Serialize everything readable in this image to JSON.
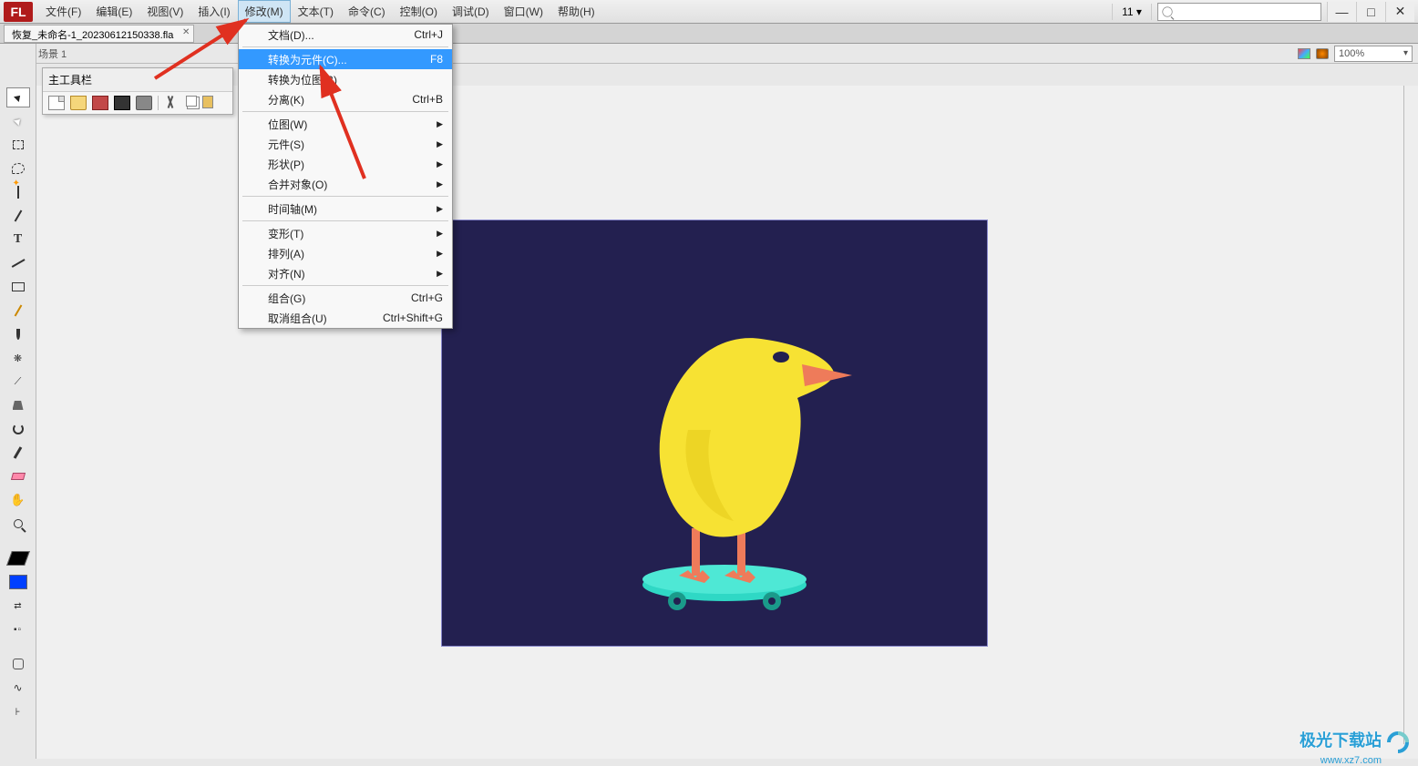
{
  "app": {
    "logo": "FL"
  },
  "menus": {
    "items": [
      {
        "label": "文件(F)"
      },
      {
        "label": "编辑(E)"
      },
      {
        "label": "视图(V)"
      },
      {
        "label": "插入(I)"
      },
      {
        "label": "修改(M)",
        "active": true
      },
      {
        "label": "文本(T)"
      },
      {
        "label": "命令(C)"
      },
      {
        "label": "控制(O)"
      },
      {
        "label": "调试(D)"
      },
      {
        "label": "窗口(W)"
      },
      {
        "label": "帮助(H)"
      }
    ]
  },
  "title_right": {
    "page": "11",
    "search_placeholder": ""
  },
  "tabs": {
    "doc": "恢复_未命名-1_20230612150338.fla"
  },
  "scene": {
    "name": "场景 1",
    "zoom": "100%"
  },
  "toolbar": {
    "title": "主工具栏"
  },
  "dropdown": {
    "items": [
      {
        "label": "文档(D)...",
        "shortcut": "Ctrl+J",
        "type": "item"
      },
      {
        "type": "sep"
      },
      {
        "label": "转换为元件(C)...",
        "shortcut": "F8",
        "type": "item",
        "highlight": true
      },
      {
        "label": "转换为位图(B)",
        "shortcut": "",
        "type": "item"
      },
      {
        "label": "分离(K)",
        "shortcut": "Ctrl+B",
        "type": "item"
      },
      {
        "type": "sep"
      },
      {
        "label": "位图(W)",
        "submenu": true,
        "type": "item"
      },
      {
        "label": "元件(S)",
        "submenu": true,
        "type": "item"
      },
      {
        "label": "形状(P)",
        "submenu": true,
        "type": "item"
      },
      {
        "label": "合并对象(O)",
        "submenu": true,
        "type": "item"
      },
      {
        "type": "sep"
      },
      {
        "label": "时间轴(M)",
        "submenu": true,
        "type": "item"
      },
      {
        "type": "sep"
      },
      {
        "label": "变形(T)",
        "submenu": true,
        "type": "item"
      },
      {
        "label": "排列(A)",
        "submenu": true,
        "type": "item"
      },
      {
        "label": "对齐(N)",
        "submenu": true,
        "type": "item"
      },
      {
        "type": "sep"
      },
      {
        "label": "组合(G)",
        "shortcut": "Ctrl+G",
        "type": "item"
      },
      {
        "label": "取消组合(U)",
        "shortcut": "Ctrl+Shift+G",
        "type": "item"
      }
    ]
  },
  "colors": {
    "stage_bg": "#232050",
    "bird_body": "#f7e233",
    "bird_beak": "#ee7b5a",
    "bird_leg": "#ee7b5a",
    "board": "#2fd8c5",
    "wheel": "#1a9a8a"
  },
  "watermark": {
    "text": "极光下载站",
    "url": "www.xz7.com"
  }
}
